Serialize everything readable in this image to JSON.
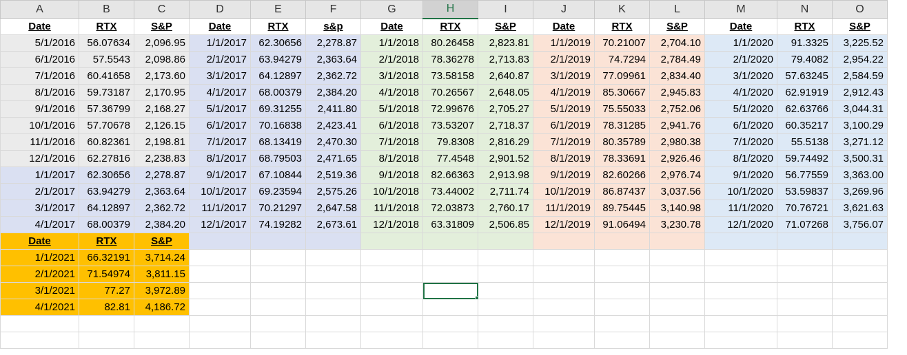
{
  "columns": [
    "A",
    "B",
    "C",
    "D",
    "E",
    "F",
    "G",
    "H",
    "I",
    "J",
    "K",
    "L",
    "M",
    "N",
    "O"
  ],
  "selected_column": "H",
  "colors": {
    "gray": "#ebebeb",
    "blue": "#dae0f2",
    "green": "#e3efdb",
    "peach": "#fbe3d6",
    "lightblue": "#dde9f6",
    "orange": "#ffc000",
    "white": "#ffffff",
    "selection": "#217346"
  },
  "rows": [
    [
      {
        "t": "Date",
        "h": true
      },
      {
        "t": "RTX",
        "h": true
      },
      {
        "t": "S&P",
        "h": true
      },
      {
        "t": "Date",
        "h": true
      },
      {
        "t": "RTX",
        "h": true
      },
      {
        "t": "s&p",
        "h": true
      },
      {
        "t": "Date",
        "h": true
      },
      {
        "t": "RTX",
        "h": true
      },
      {
        "t": "S&P",
        "h": true
      },
      {
        "t": "Date",
        "h": true
      },
      {
        "t": "RTX",
        "h": true
      },
      {
        "t": "S&P",
        "h": true
      },
      {
        "t": "Date",
        "h": true
      },
      {
        "t": "RTX",
        "h": true
      },
      {
        "t": "S&P",
        "h": true
      }
    ],
    [
      {
        "t": "5/1/2016",
        "bg": "gray"
      },
      {
        "t": "56.07634",
        "bg": "gray"
      },
      {
        "t": "2,096.95",
        "bg": "gray"
      },
      {
        "t": "1/1/2017",
        "bg": "blue"
      },
      {
        "t": "62.30656",
        "bg": "blue"
      },
      {
        "t": "2,278.87",
        "bg": "blue"
      },
      {
        "t": "1/1/2018",
        "bg": "green"
      },
      {
        "t": "80.26458",
        "bg": "green"
      },
      {
        "t": "2,823.81",
        "bg": "green"
      },
      {
        "t": "1/1/2019",
        "bg": "peach"
      },
      {
        "t": "70.21007",
        "bg": "peach"
      },
      {
        "t": "2,704.10",
        "bg": "peach"
      },
      {
        "t": "1/1/2020",
        "bg": "lightblue"
      },
      {
        "t": "91.3325",
        "bg": "lightblue"
      },
      {
        "t": "3,225.52",
        "bg": "lightblue"
      }
    ],
    [
      {
        "t": "6/1/2016",
        "bg": "gray"
      },
      {
        "t": "57.5543",
        "bg": "gray"
      },
      {
        "t": "2,098.86",
        "bg": "gray"
      },
      {
        "t": "2/1/2017",
        "bg": "blue"
      },
      {
        "t": "63.94279",
        "bg": "blue"
      },
      {
        "t": "2,363.64",
        "bg": "blue"
      },
      {
        "t": "2/1/2018",
        "bg": "green"
      },
      {
        "t": "78.36278",
        "bg": "green"
      },
      {
        "t": "2,713.83",
        "bg": "green"
      },
      {
        "t": "2/1/2019",
        "bg": "peach"
      },
      {
        "t": "74.7294",
        "bg": "peach"
      },
      {
        "t": "2,784.49",
        "bg": "peach"
      },
      {
        "t": "2/1/2020",
        "bg": "lightblue"
      },
      {
        "t": "79.4082",
        "bg": "lightblue"
      },
      {
        "t": "2,954.22",
        "bg": "lightblue"
      }
    ],
    [
      {
        "t": "7/1/2016",
        "bg": "gray"
      },
      {
        "t": "60.41658",
        "bg": "gray"
      },
      {
        "t": "2,173.60",
        "bg": "gray"
      },
      {
        "t": "3/1/2017",
        "bg": "blue"
      },
      {
        "t": "64.12897",
        "bg": "blue"
      },
      {
        "t": "2,362.72",
        "bg": "blue"
      },
      {
        "t": "3/1/2018",
        "bg": "green"
      },
      {
        "t": "73.58158",
        "bg": "green"
      },
      {
        "t": "2,640.87",
        "bg": "green"
      },
      {
        "t": "3/1/2019",
        "bg": "peach"
      },
      {
        "t": "77.09961",
        "bg": "peach"
      },
      {
        "t": "2,834.40",
        "bg": "peach"
      },
      {
        "t": "3/1/2020",
        "bg": "lightblue"
      },
      {
        "t": "57.63245",
        "bg": "lightblue"
      },
      {
        "t": "2,584.59",
        "bg": "lightblue"
      }
    ],
    [
      {
        "t": "8/1/2016",
        "bg": "gray"
      },
      {
        "t": "59.73187",
        "bg": "gray"
      },
      {
        "t": "2,170.95",
        "bg": "gray"
      },
      {
        "t": "4/1/2017",
        "bg": "blue"
      },
      {
        "t": "68.00379",
        "bg": "blue"
      },
      {
        "t": "2,384.20",
        "bg": "blue"
      },
      {
        "t": "4/1/2018",
        "bg": "green"
      },
      {
        "t": "70.26567",
        "bg": "green"
      },
      {
        "t": "2,648.05",
        "bg": "green"
      },
      {
        "t": "4/1/2019",
        "bg": "peach"
      },
      {
        "t": "85.30667",
        "bg": "peach"
      },
      {
        "t": "2,945.83",
        "bg": "peach"
      },
      {
        "t": "4/1/2020",
        "bg": "lightblue"
      },
      {
        "t": "62.91919",
        "bg": "lightblue"
      },
      {
        "t": "2,912.43",
        "bg": "lightblue"
      }
    ],
    [
      {
        "t": "9/1/2016",
        "bg": "gray"
      },
      {
        "t": "57.36799",
        "bg": "gray"
      },
      {
        "t": "2,168.27",
        "bg": "gray"
      },
      {
        "t": "5/1/2017",
        "bg": "blue"
      },
      {
        "t": "69.31255",
        "bg": "blue"
      },
      {
        "t": "2,411.80",
        "bg": "blue"
      },
      {
        "t": "5/1/2018",
        "bg": "green"
      },
      {
        "t": "72.99676",
        "bg": "green"
      },
      {
        "t": "2,705.27",
        "bg": "green"
      },
      {
        "t": "5/1/2019",
        "bg": "peach"
      },
      {
        "t": "75.55033",
        "bg": "peach"
      },
      {
        "t": "2,752.06",
        "bg": "peach"
      },
      {
        "t": "5/1/2020",
        "bg": "lightblue"
      },
      {
        "t": "62.63766",
        "bg": "lightblue"
      },
      {
        "t": "3,044.31",
        "bg": "lightblue"
      }
    ],
    [
      {
        "t": "10/1/2016",
        "bg": "gray"
      },
      {
        "t": "57.70678",
        "bg": "gray"
      },
      {
        "t": "2,126.15",
        "bg": "gray"
      },
      {
        "t": "6/1/2017",
        "bg": "blue"
      },
      {
        "t": "70.16838",
        "bg": "blue"
      },
      {
        "t": "2,423.41",
        "bg": "blue"
      },
      {
        "t": "6/1/2018",
        "bg": "green"
      },
      {
        "t": "73.53207",
        "bg": "green"
      },
      {
        "t": "2,718.37",
        "bg": "green"
      },
      {
        "t": "6/1/2019",
        "bg": "peach"
      },
      {
        "t": "78.31285",
        "bg": "peach"
      },
      {
        "t": "2,941.76",
        "bg": "peach"
      },
      {
        "t": "6/1/2020",
        "bg": "lightblue"
      },
      {
        "t": "60.35217",
        "bg": "lightblue"
      },
      {
        "t": "3,100.29",
        "bg": "lightblue"
      }
    ],
    [
      {
        "t": "11/1/2016",
        "bg": "gray"
      },
      {
        "t": "60.82361",
        "bg": "gray"
      },
      {
        "t": "2,198.81",
        "bg": "gray"
      },
      {
        "t": "7/1/2017",
        "bg": "blue"
      },
      {
        "t": "68.13419",
        "bg": "blue"
      },
      {
        "t": "2,470.30",
        "bg": "blue"
      },
      {
        "t": "7/1/2018",
        "bg": "green"
      },
      {
        "t": "79.8308",
        "bg": "green"
      },
      {
        "t": "2,816.29",
        "bg": "green"
      },
      {
        "t": "7/1/2019",
        "bg": "peach"
      },
      {
        "t": "80.35789",
        "bg": "peach"
      },
      {
        "t": "2,980.38",
        "bg": "peach"
      },
      {
        "t": "7/1/2020",
        "bg": "lightblue"
      },
      {
        "t": "55.5138",
        "bg": "lightblue"
      },
      {
        "t": "3,271.12",
        "bg": "lightblue"
      }
    ],
    [
      {
        "t": "12/1/2016",
        "bg": "gray"
      },
      {
        "t": "62.27816",
        "bg": "gray"
      },
      {
        "t": "2,238.83",
        "bg": "gray"
      },
      {
        "t": "8/1/2017",
        "bg": "blue"
      },
      {
        "t": "68.79503",
        "bg": "blue"
      },
      {
        "t": "2,471.65",
        "bg": "blue"
      },
      {
        "t": "8/1/2018",
        "bg": "green"
      },
      {
        "t": "77.4548",
        "bg": "green"
      },
      {
        "t": "2,901.52",
        "bg": "green"
      },
      {
        "t": "8/1/2019",
        "bg": "peach"
      },
      {
        "t": "78.33691",
        "bg": "peach"
      },
      {
        "t": "2,926.46",
        "bg": "peach"
      },
      {
        "t": "8/1/2020",
        "bg": "lightblue"
      },
      {
        "t": "59.74492",
        "bg": "lightblue"
      },
      {
        "t": "3,500.31",
        "bg": "lightblue"
      }
    ],
    [
      {
        "t": "1/1/2017",
        "bg": "blue"
      },
      {
        "t": "62.30656",
        "bg": "blue"
      },
      {
        "t": "2,278.87",
        "bg": "blue"
      },
      {
        "t": "9/1/2017",
        "bg": "blue"
      },
      {
        "t": "67.10844",
        "bg": "blue"
      },
      {
        "t": "2,519.36",
        "bg": "blue"
      },
      {
        "t": "9/1/2018",
        "bg": "green"
      },
      {
        "t": "82.66363",
        "bg": "green"
      },
      {
        "t": "2,913.98",
        "bg": "green"
      },
      {
        "t": "9/1/2019",
        "bg": "peach"
      },
      {
        "t": "82.60266",
        "bg": "peach"
      },
      {
        "t": "2,976.74",
        "bg": "peach"
      },
      {
        "t": "9/1/2020",
        "bg": "lightblue"
      },
      {
        "t": "56.77559",
        "bg": "lightblue"
      },
      {
        "t": "3,363.00",
        "bg": "lightblue"
      }
    ],
    [
      {
        "t": "2/1/2017",
        "bg": "blue"
      },
      {
        "t": "63.94279",
        "bg": "blue"
      },
      {
        "t": "2,363.64",
        "bg": "blue"
      },
      {
        "t": "10/1/2017",
        "bg": "blue"
      },
      {
        "t": "69.23594",
        "bg": "blue"
      },
      {
        "t": "2,575.26",
        "bg": "blue"
      },
      {
        "t": "10/1/2018",
        "bg": "green"
      },
      {
        "t": "73.44002",
        "bg": "green"
      },
      {
        "t": "2,711.74",
        "bg": "green"
      },
      {
        "t": "10/1/2019",
        "bg": "peach"
      },
      {
        "t": "86.87437",
        "bg": "peach"
      },
      {
        "t": "3,037.56",
        "bg": "peach"
      },
      {
        "t": "10/1/2020",
        "bg": "lightblue"
      },
      {
        "t": "53.59837",
        "bg": "lightblue"
      },
      {
        "t": "3,269.96",
        "bg": "lightblue"
      }
    ],
    [
      {
        "t": "3/1/2017",
        "bg": "blue"
      },
      {
        "t": "64.12897",
        "bg": "blue"
      },
      {
        "t": "2,362.72",
        "bg": "blue"
      },
      {
        "t": "11/1/2017",
        "bg": "blue"
      },
      {
        "t": "70.21297",
        "bg": "blue"
      },
      {
        "t": "2,647.58",
        "bg": "blue"
      },
      {
        "t": "11/1/2018",
        "bg": "green"
      },
      {
        "t": "72.03873",
        "bg": "green"
      },
      {
        "t": "2,760.17",
        "bg": "green"
      },
      {
        "t": "11/1/2019",
        "bg": "peach"
      },
      {
        "t": "89.75445",
        "bg": "peach"
      },
      {
        "t": "3,140.98",
        "bg": "peach"
      },
      {
        "t": "11/1/2020",
        "bg": "lightblue"
      },
      {
        "t": "70.76721",
        "bg": "lightblue"
      },
      {
        "t": "3,621.63",
        "bg": "lightblue"
      }
    ],
    [
      {
        "t": "4/1/2017",
        "bg": "blue"
      },
      {
        "t": "68.00379",
        "bg": "blue"
      },
      {
        "t": "2,384.20",
        "bg": "blue"
      },
      {
        "t": "12/1/2017",
        "bg": "blue"
      },
      {
        "t": "74.19282",
        "bg": "blue"
      },
      {
        "t": "2,673.61",
        "bg": "blue"
      },
      {
        "t": "12/1/2018",
        "bg": "green"
      },
      {
        "t": "63.31809",
        "bg": "green"
      },
      {
        "t": "2,506.85",
        "bg": "green"
      },
      {
        "t": "12/1/2019",
        "bg": "peach"
      },
      {
        "t": "91.06494",
        "bg": "peach"
      },
      {
        "t": "3,230.78",
        "bg": "peach"
      },
      {
        "t": "12/1/2020",
        "bg": "lightblue"
      },
      {
        "t": "71.07268",
        "bg": "lightblue"
      },
      {
        "t": "3,756.07",
        "bg": "lightblue"
      }
    ],
    [
      {
        "t": "Date",
        "h": true,
        "bg": "orange"
      },
      {
        "t": "RTX",
        "h": true,
        "bg": "orange"
      },
      {
        "t": "S&P",
        "h": true,
        "bg": "orange"
      },
      {
        "t": "",
        "bg": "blue"
      },
      {
        "t": "",
        "bg": "blue"
      },
      {
        "t": "",
        "bg": "blue"
      },
      {
        "t": "",
        "bg": "green"
      },
      {
        "t": "",
        "bg": "green"
      },
      {
        "t": "",
        "bg": "green"
      },
      {
        "t": "",
        "bg": "peach"
      },
      {
        "t": "",
        "bg": "peach"
      },
      {
        "t": "",
        "bg": "peach"
      },
      {
        "t": "",
        "bg": "lightblue"
      },
      {
        "t": "",
        "bg": "lightblue"
      },
      {
        "t": "",
        "bg": "lightblue"
      }
    ],
    [
      {
        "t": "1/1/2021",
        "bg": "orange"
      },
      {
        "t": "66.32191",
        "bg": "orange"
      },
      {
        "t": "3,714.24",
        "bg": "orange"
      },
      {
        "t": ""
      },
      {
        "t": ""
      },
      {
        "t": ""
      },
      {
        "t": ""
      },
      {
        "t": ""
      },
      {
        "t": ""
      },
      {
        "t": ""
      },
      {
        "t": ""
      },
      {
        "t": ""
      },
      {
        "t": ""
      },
      {
        "t": ""
      },
      {
        "t": ""
      }
    ],
    [
      {
        "t": "2/1/2021",
        "bg": "orange"
      },
      {
        "t": "71.54974",
        "bg": "orange"
      },
      {
        "t": "3,811.15",
        "bg": "orange"
      },
      {
        "t": ""
      },
      {
        "t": ""
      },
      {
        "t": ""
      },
      {
        "t": ""
      },
      {
        "t": ""
      },
      {
        "t": ""
      },
      {
        "t": ""
      },
      {
        "t": ""
      },
      {
        "t": ""
      },
      {
        "t": ""
      },
      {
        "t": ""
      },
      {
        "t": ""
      }
    ],
    [
      {
        "t": "3/1/2021",
        "bg": "orange"
      },
      {
        "t": "77.27",
        "bg": "orange"
      },
      {
        "t": "3,972.89",
        "bg": "orange"
      },
      {
        "t": ""
      },
      {
        "t": ""
      },
      {
        "t": ""
      },
      {
        "t": ""
      },
      {
        "t": "",
        "sel": true
      },
      {
        "t": ""
      },
      {
        "t": ""
      },
      {
        "t": ""
      },
      {
        "t": ""
      },
      {
        "t": ""
      },
      {
        "t": ""
      },
      {
        "t": ""
      }
    ],
    [
      {
        "t": "4/1/2021",
        "bg": "orange"
      },
      {
        "t": "82.81",
        "bg": "orange"
      },
      {
        "t": "4,186.72",
        "bg": "orange"
      },
      {
        "t": ""
      },
      {
        "t": ""
      },
      {
        "t": ""
      },
      {
        "t": ""
      },
      {
        "t": ""
      },
      {
        "t": ""
      },
      {
        "t": ""
      },
      {
        "t": ""
      },
      {
        "t": ""
      },
      {
        "t": ""
      },
      {
        "t": ""
      },
      {
        "t": ""
      }
    ],
    [
      {
        "t": ""
      },
      {
        "t": ""
      },
      {
        "t": ""
      },
      {
        "t": ""
      },
      {
        "t": ""
      },
      {
        "t": ""
      },
      {
        "t": ""
      },
      {
        "t": ""
      },
      {
        "t": ""
      },
      {
        "t": ""
      },
      {
        "t": ""
      },
      {
        "t": ""
      },
      {
        "t": ""
      },
      {
        "t": ""
      },
      {
        "t": ""
      }
    ],
    [
      {
        "t": ""
      },
      {
        "t": ""
      },
      {
        "t": ""
      },
      {
        "t": ""
      },
      {
        "t": ""
      },
      {
        "t": ""
      },
      {
        "t": ""
      },
      {
        "t": ""
      },
      {
        "t": ""
      },
      {
        "t": ""
      },
      {
        "t": ""
      },
      {
        "t": ""
      },
      {
        "t": ""
      },
      {
        "t": ""
      },
      {
        "t": ""
      }
    ]
  ]
}
